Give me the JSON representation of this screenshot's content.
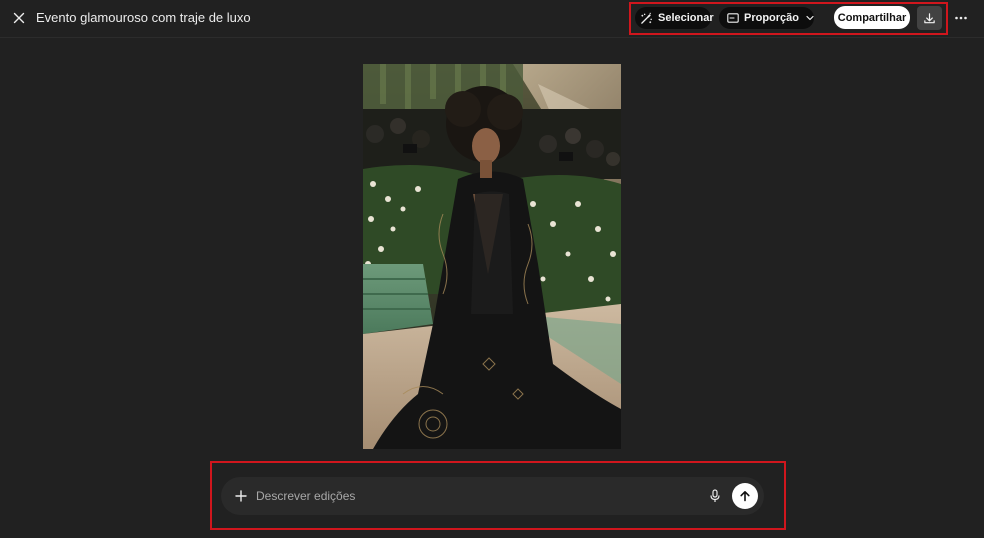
{
  "header": {
    "title": "Evento glamouroso com traje de luxo",
    "select_label": "Selecionar",
    "ratio_label": "Proporção",
    "share_label": "Compartilhar"
  },
  "icons": {
    "close": "close-icon",
    "select": "magic-select-icon",
    "ratio": "aspect-ratio-icon",
    "ratio_dropdown": "chevron-down-icon",
    "download": "download-icon",
    "more": "more-horizontal-icon",
    "add": "plus-icon",
    "mic": "microphone-icon",
    "send": "arrow-up-icon"
  },
  "composer": {
    "placeholder": "Descrever edições",
    "value": ""
  },
  "colors": {
    "background": "#212121",
    "highlight": "#d0161d",
    "pill_dark": "#0d0d0d",
    "share_bg": "#ffffff",
    "composer_bg": "#2a2a2a"
  }
}
